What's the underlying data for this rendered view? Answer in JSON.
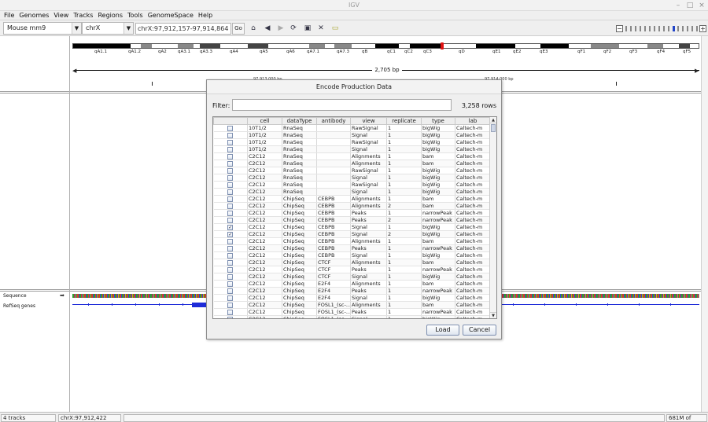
{
  "window": {
    "title": "IGV",
    "controls": [
      "–",
      "□",
      "×"
    ]
  },
  "menu": [
    "File",
    "Genomes",
    "View",
    "Tracks",
    "Regions",
    "Tools",
    "GenomeSpace",
    "Help"
  ],
  "toolbar": {
    "genome": "Mouse mm9",
    "chromosome": "chrX",
    "locus": "chrX:97,912,157-97,914,864",
    "go_label": "Go"
  },
  "ideogram": {
    "bands": [
      "qA1.1",
      "qA1.2",
      "qA2",
      "qA3.1",
      "qA3.3",
      "qA4",
      "qA5",
      "qA6",
      "qA7.1",
      "qA7.3",
      "qB",
      "qC1",
      "qC2",
      "qC3",
      "qD",
      "qE1",
      "qE2",
      "qE3",
      "qF1",
      "qF2",
      "qF3",
      "qF4",
      "qF5"
    ]
  },
  "ruler": {
    "span": "2,705 bp",
    "left_pos": "97,913,000 bp",
    "right_pos": "97,914,000 bp"
  },
  "tracks": {
    "sequence": "Sequence",
    "refseq": "RefSeq genes"
  },
  "dialog": {
    "title": "Encode Production Data",
    "filter_label": "Filter:",
    "filter_value": "",
    "row_count": "3,258 rows",
    "columns": [
      "",
      "cell",
      "dataType",
      "antibody",
      "view",
      "replicate",
      "type",
      "lab"
    ],
    "rows": [
      {
        "checked": false,
        "cells": [
          "10T1/2",
          "RnaSeq",
          "",
          "RawSignal",
          "1",
          "bigWig",
          "Caltech-m"
        ]
      },
      {
        "checked": false,
        "cells": [
          "10T1/2",
          "RnaSeq",
          "",
          "Signal",
          "1",
          "bigWig",
          "Caltech-m"
        ]
      },
      {
        "checked": false,
        "cells": [
          "10T1/2",
          "RnaSeq",
          "",
          "RawSignal",
          "1",
          "bigWig",
          "Caltech-m"
        ]
      },
      {
        "checked": false,
        "cells": [
          "10T1/2",
          "RnaSeq",
          "",
          "Signal",
          "1",
          "bigWig",
          "Caltech-m"
        ]
      },
      {
        "checked": false,
        "cells": [
          "C2C12",
          "RnaSeq",
          "",
          "Alignments",
          "1",
          "bam",
          "Caltech-m"
        ]
      },
      {
        "checked": false,
        "cells": [
          "C2C12",
          "RnaSeq",
          "",
          "Alignments",
          "1",
          "bam",
          "Caltech-m"
        ]
      },
      {
        "checked": false,
        "cells": [
          "C2C12",
          "RnaSeq",
          "",
          "RawSignal",
          "1",
          "bigWig",
          "Caltech-m"
        ]
      },
      {
        "checked": false,
        "cells": [
          "C2C12",
          "RnaSeq",
          "",
          "Signal",
          "1",
          "bigWig",
          "Caltech-m"
        ]
      },
      {
        "checked": false,
        "cells": [
          "C2C12",
          "RnaSeq",
          "",
          "RawSignal",
          "1",
          "bigWig",
          "Caltech-m"
        ]
      },
      {
        "checked": false,
        "cells": [
          "C2C12",
          "RnaSeq",
          "",
          "Signal",
          "1",
          "bigWig",
          "Caltech-m"
        ]
      },
      {
        "checked": false,
        "cells": [
          "C2C12",
          "ChipSeq",
          "CEBPB",
          "Alignments",
          "1",
          "bam",
          "Caltech-m"
        ]
      },
      {
        "checked": false,
        "cells": [
          "C2C12",
          "ChipSeq",
          "CEBPB",
          "Alignments",
          "2",
          "bam",
          "Caltech-m"
        ]
      },
      {
        "checked": false,
        "cells": [
          "C2C12",
          "ChipSeq",
          "CEBPB",
          "Peaks",
          "1",
          "narrowPeak",
          "Caltech-m"
        ]
      },
      {
        "checked": false,
        "cells": [
          "C2C12",
          "ChipSeq",
          "CEBPB",
          "Peaks",
          "2",
          "narrowPeak",
          "Caltech-m"
        ]
      },
      {
        "checked": true,
        "cells": [
          "C2C12",
          "ChipSeq",
          "CEBPB",
          "Signal",
          "1",
          "bigWig",
          "Caltech-m"
        ]
      },
      {
        "checked": true,
        "cells": [
          "C2C12",
          "ChipSeq",
          "CEBPB",
          "Signal",
          "2",
          "bigWig",
          "Caltech-m"
        ]
      },
      {
        "checked": false,
        "cells": [
          "C2C12",
          "ChipSeq",
          "CEBPB",
          "Alignments",
          "1",
          "bam",
          "Caltech-m"
        ]
      },
      {
        "checked": false,
        "cells": [
          "C2C12",
          "ChipSeq",
          "CEBPB",
          "Peaks",
          "1",
          "narrowPeak",
          "Caltech-m"
        ]
      },
      {
        "checked": false,
        "cells": [
          "C2C12",
          "ChipSeq",
          "CEBPB",
          "Signal",
          "1",
          "bigWig",
          "Caltech-m"
        ]
      },
      {
        "checked": false,
        "cells": [
          "C2C12",
          "ChipSeq",
          "CTCF",
          "Alignments",
          "1",
          "bam",
          "Caltech-m"
        ]
      },
      {
        "checked": false,
        "cells": [
          "C2C12",
          "ChipSeq",
          "CTCF",
          "Peaks",
          "1",
          "narrowPeak",
          "Caltech-m"
        ]
      },
      {
        "checked": false,
        "cells": [
          "C2C12",
          "ChipSeq",
          "CTCF",
          "Signal",
          "1",
          "bigWig",
          "Caltech-m"
        ]
      },
      {
        "checked": false,
        "cells": [
          "C2C12",
          "ChipSeq",
          "E2F4",
          "Alignments",
          "1",
          "bam",
          "Caltech-m"
        ]
      },
      {
        "checked": false,
        "cells": [
          "C2C12",
          "ChipSeq",
          "E2F4",
          "Peaks",
          "1",
          "narrowPeak",
          "Caltech-m"
        ]
      },
      {
        "checked": false,
        "cells": [
          "C2C12",
          "ChipSeq",
          "E2F4",
          "Signal",
          "1",
          "bigWig",
          "Caltech-m"
        ]
      },
      {
        "checked": false,
        "cells": [
          "C2C12",
          "ChipSeq",
          "FOSL1_(sc-...",
          "Alignments",
          "1",
          "bam",
          "Caltech-m"
        ]
      },
      {
        "checked": false,
        "cells": [
          "C2C12",
          "ChipSeq",
          "FOSL1_(sc-...",
          "Peaks",
          "1",
          "narrowPeak",
          "Caltech-m"
        ]
      },
      {
        "checked": false,
        "cells": [
          "C2C12",
          "ChipSeq",
          "FOSL1_(sc-...",
          "Signal",
          "1",
          "bigWig",
          "Caltech-m"
        ]
      },
      {
        "checked": false,
        "cells": [
          "C2C12",
          "ChipSeq",
          "Input",
          "Alignments",
          "1",
          "bam",
          "Caltech-m"
        ]
      }
    ],
    "load_label": "Load",
    "cancel_label": "Cancel"
  },
  "status": {
    "tracks": "4 tracks",
    "position": "chrX:97,912,422",
    "memory": "681M of 932M"
  }
}
